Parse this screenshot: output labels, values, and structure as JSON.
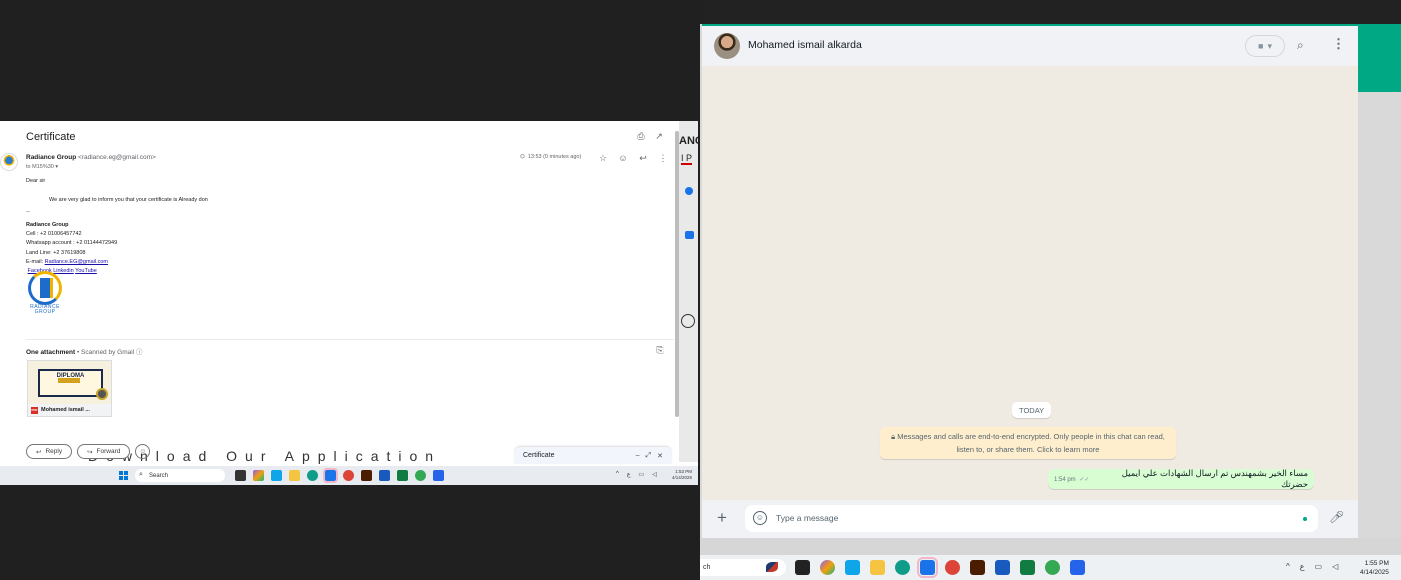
{
  "gmail": {
    "subject": "Certificate",
    "sender_name": "Radiance Group",
    "sender_email": "<radiance.eg@gmail.com>",
    "to": "to M15%30",
    "time": "13:53 (0 minutes ago)",
    "greeting": "Dear sir",
    "message": "We are very glad to inform you that your certificate is Already don",
    "sig_dash": "--",
    "sig_company": "Radiance Group",
    "cell": "Cell : +2 01006457742",
    "whatsapp": "Whatsapp account : +2 01144472949",
    "landline": "Land Line: +2 37619808",
    "email_label": "E-mail: ",
    "email_link": "Radiance.EG@gmail.com",
    "links": [
      "Facebook",
      "Linkedin",
      "YouTube"
    ],
    "logo_text_1": "RADIANCE",
    "logo_text_2": "GROUP",
    "attach_count": "One attachment",
    "scanned": " • Scanned by Gmail",
    "diploma": "DIPLOMA",
    "attach_file": "Mohamed ismail ...",
    "reply": "Reply",
    "forward": "Forward",
    "ghost_text": "Download Our Application",
    "compose_title": "Certificate",
    "side_text_a": "ANC",
    "side_text_b": "I P"
  },
  "left_taskbar": {
    "search": "Search",
    "time": "1:53 PM",
    "date": "4/14/2025",
    "lang": "ع"
  },
  "whatsapp": {
    "contact_name": "Mohamed ismail alkarda",
    "today": "TODAY",
    "encryption_line1": "Messages and calls are end-to-end encrypted. Only people in this chat can read,",
    "encryption_line2": "listen to, or share them. Click to learn more",
    "message_text": "مساء الخير بشمهندس تم ارسال الشهادات علي ايميل حضرتك",
    "message_time": "1:54 pm",
    "input_placeholder": "Type a message"
  },
  "right_taskbar": {
    "search_partial": "ch",
    "lang": "ع",
    "time": "1:55 PM",
    "date": "4/14/2025"
  },
  "colors": {
    "wa_accent": "#00a884",
    "bubble": "#d9fdd3",
    "encryption_bg": "#ffeecd",
    "gmail_link": "#1a0dab"
  }
}
